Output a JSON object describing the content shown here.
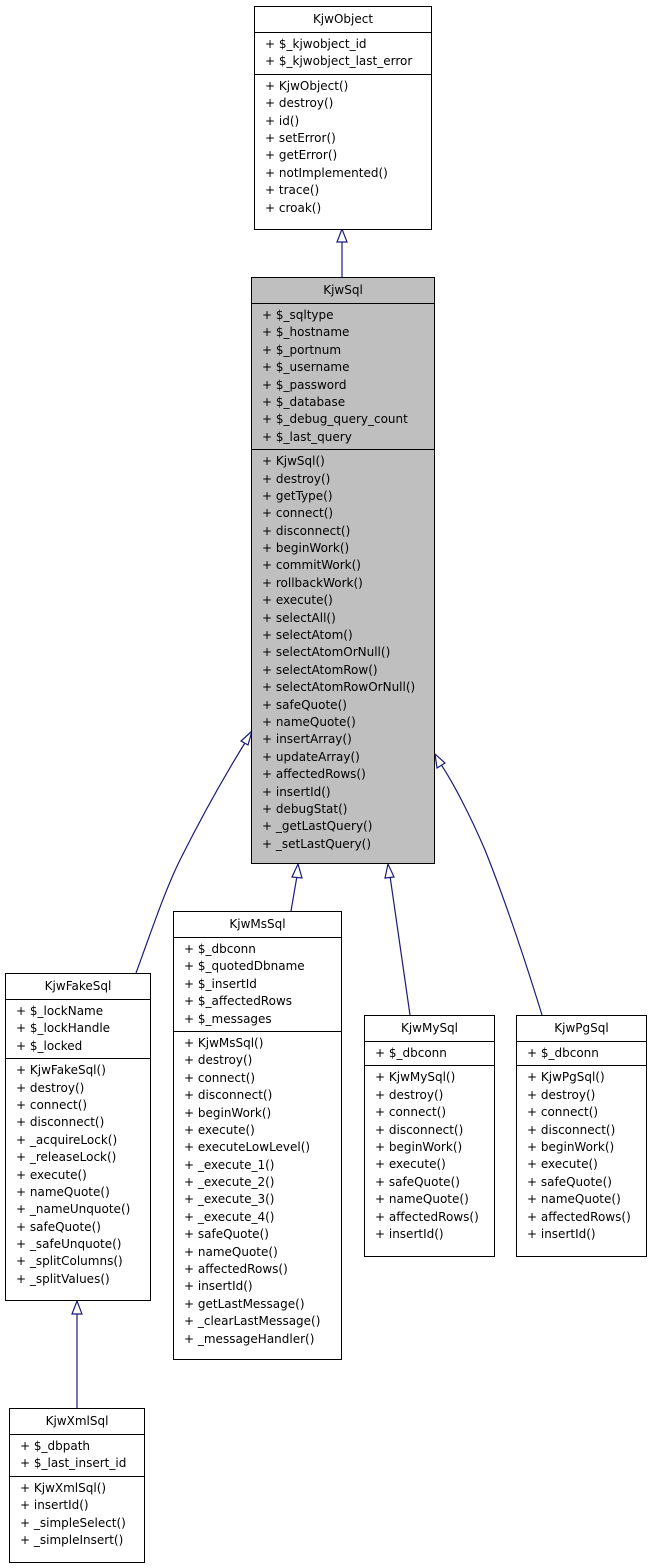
{
  "diagram": {
    "type": "class-inheritance",
    "edge_color": "#1a1a7a",
    "highlight_color": "#bfbfbf",
    "classes": {
      "KjwObject": {
        "name": "KjwObject",
        "attributes": [
          "+ $_kjwobject_id",
          "+ $_kjwobject_last_error"
        ],
        "methods": [
          "+ KjwObject()",
          "+ destroy()",
          "+ id()",
          "+ setError()",
          "+ getError()",
          "+ notImplemented()",
          "+ trace()",
          "+ croak()"
        ]
      },
      "KjwSql": {
        "name": "KjwSql",
        "highlighted": true,
        "attributes": [
          "+ $_sqltype",
          "+ $_hostname",
          "+ $_portnum",
          "+ $_username",
          "+ $_password",
          "+ $_database",
          "+ $_debug_query_count",
          "+ $_last_query"
        ],
        "methods": [
          "+ KjwSql()",
          "+ destroy()",
          "+ getType()",
          "+ connect()",
          "+ disconnect()",
          "+ beginWork()",
          "+ commitWork()",
          "+ rollbackWork()",
          "+ execute()",
          "+ selectAll()",
          "+ selectAtom()",
          "+ selectAtomOrNull()",
          "+ selectAtomRow()",
          "+ selectAtomRowOrNull()",
          "+ safeQuote()",
          "+ nameQuote()",
          "+ insertArray()",
          "+ updateArray()",
          "+ affectedRows()",
          "+ insertId()",
          "+ debugStat()",
          "+ _getLastQuery()",
          "+ _setLastQuery()"
        ]
      },
      "KjwFakeSql": {
        "name": "KjwFakeSql",
        "attributes": [
          "+ $_lockName",
          "+ $_lockHandle",
          "+ $_locked"
        ],
        "methods": [
          "+ KjwFakeSql()",
          "+ destroy()",
          "+ connect()",
          "+ disconnect()",
          "+ _acquireLock()",
          "+ _releaseLock()",
          "+ execute()",
          "+ nameQuote()",
          "+ _nameUnquote()",
          "+ safeQuote()",
          "+ _safeUnquote()",
          "+ _splitColumns()",
          "+ _splitValues()"
        ]
      },
      "KjwMsSql": {
        "name": "KjwMsSql",
        "attributes": [
          "+ $_dbconn",
          "+ $_quotedDbname",
          "+ $_insertId",
          "+ $_affectedRows",
          "+ $_messages"
        ],
        "methods": [
          "+ KjwMsSql()",
          "+ destroy()",
          "+ connect()",
          "+ disconnect()",
          "+ beginWork()",
          "+ execute()",
          "+ executeLowLevel()",
          "+ _execute_1()",
          "+ _execute_2()",
          "+ _execute_3()",
          "+ _execute_4()",
          "+ safeQuote()",
          "+ nameQuote()",
          "+ affectedRows()",
          "+ insertId()",
          "+ getLastMessage()",
          "+ _clearLastMessage()",
          "+ _messageHandler()"
        ]
      },
      "KjwMySql": {
        "name": "KjwMySql",
        "attributes": [
          "+ $_dbconn"
        ],
        "methods": [
          "+ KjwMySql()",
          "+ destroy()",
          "+ connect()",
          "+ disconnect()",
          "+ beginWork()",
          "+ execute()",
          "+ safeQuote()",
          "+ nameQuote()",
          "+ affectedRows()",
          "+ insertId()"
        ]
      },
      "KjwPgSql": {
        "name": "KjwPgSql",
        "attributes": [
          "+ $_dbconn"
        ],
        "methods": [
          "+ KjwPgSql()",
          "+ destroy()",
          "+ connect()",
          "+ disconnect()",
          "+ beginWork()",
          "+ execute()",
          "+ safeQuote()",
          "+ nameQuote()",
          "+ affectedRows()",
          "+ insertId()"
        ]
      },
      "KjwXmlSql": {
        "name": "KjwXmlSql",
        "attributes": [
          "+ $_dbpath",
          "+ $_last_insert_id"
        ],
        "methods": [
          "+ KjwXmlSql()",
          "+ insertId()",
          "+ _simpleSelect()",
          "+ _simpleInsert()"
        ]
      }
    },
    "edges": [
      {
        "from": "KjwSql",
        "to": "KjwObject",
        "kind": "inherits"
      },
      {
        "from": "KjwFakeSql",
        "to": "KjwSql",
        "kind": "inherits"
      },
      {
        "from": "KjwMsSql",
        "to": "KjwSql",
        "kind": "inherits"
      },
      {
        "from": "KjwMySql",
        "to": "KjwSql",
        "kind": "inherits"
      },
      {
        "from": "KjwPgSql",
        "to": "KjwSql",
        "kind": "inherits"
      },
      {
        "from": "KjwXmlSql",
        "to": "KjwFakeSql",
        "kind": "inherits"
      }
    ]
  }
}
